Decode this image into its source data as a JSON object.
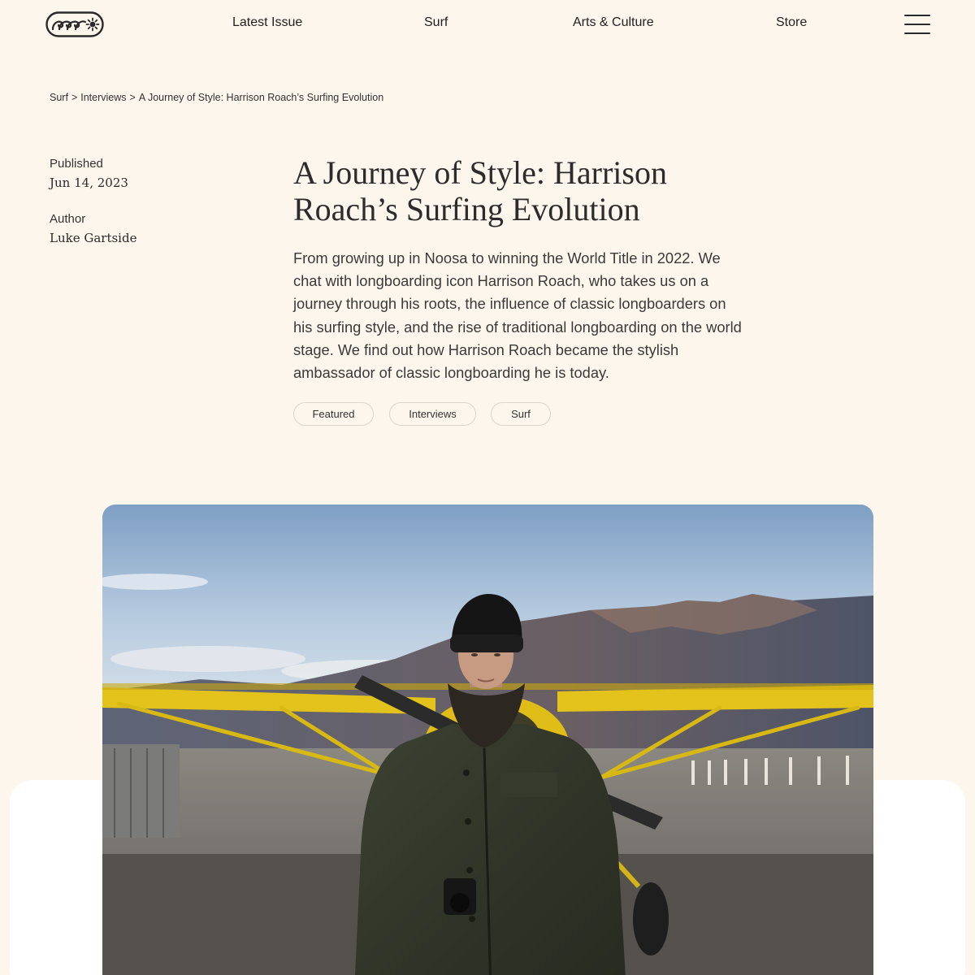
{
  "header": {
    "logo_name": "wave-sun-logo",
    "nav": [
      {
        "label": "Latest Issue"
      },
      {
        "label": "Surf"
      },
      {
        "label": "Arts & Culture"
      },
      {
        "label": "Store"
      }
    ],
    "menu_icon": "hamburger-menu-icon"
  },
  "breadcrumb": {
    "items": [
      "Surf",
      "Interviews",
      "A Journey of Style: Harrison Roach’s Surfing Evolution"
    ],
    "separator": ">"
  },
  "meta": {
    "published_label": "Published",
    "published_value": "Jun 14, 2023",
    "author_label": "Author",
    "author_value": "Luke Gartside"
  },
  "article": {
    "title": "A Journey of Style: Harrison Roach’s Surfing Evolution",
    "lede": "From growing up in Noosa to winning the World Title in 2022. We chat with longboarding icon Harrison Roach, who takes us on a journey through his roots, the influence of classic longboarders on his surfing style, and the rise of traditional longboarding on the world stage. We find out how Harrison Roach became the stylish ambassador of classic longboarding he is today.",
    "tags": [
      "Featured",
      "Interviews",
      "Surf"
    ]
  },
  "colors": {
    "background": "#fdf6ec",
    "text": "#2a2a2a",
    "tag_border": "#dcd5c9",
    "panel": "#ffffff"
  }
}
